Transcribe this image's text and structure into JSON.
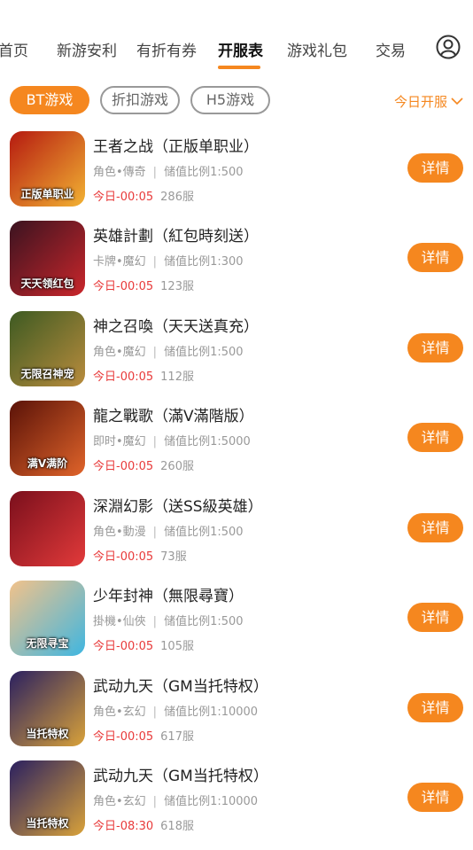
{
  "nav": {
    "items": [
      {
        "label": "首页"
      },
      {
        "label": "新游安利"
      },
      {
        "label": "有折有券"
      },
      {
        "label": "开服表",
        "active": true
      },
      {
        "label": "游戏礼包"
      },
      {
        "label": "交易"
      }
    ],
    "accent_color": "#f5871f"
  },
  "filters": {
    "chips": [
      {
        "label": "BT游戏",
        "active": true
      },
      {
        "label": "折扣游戏",
        "active": false
      },
      {
        "label": "H5游戏",
        "active": false
      }
    ],
    "date_filter": "今日开服"
  },
  "games": [
    {
      "title": "王者之战（正版单职业）",
      "genre": "角色•傳奇",
      "ratio": "储值比例1:500",
      "time": "今日-00:05",
      "server": "286服",
      "button": "详情",
      "icon_text": "正版单职业",
      "icon_colors": [
        "#b51a10",
        "#f2b233"
      ]
    },
    {
      "title": "英雄計劃（紅包時刻送）",
      "genre": "卡牌•魔幻",
      "ratio": "储值比例1:300",
      "time": "今日-00:05",
      "server": "123服",
      "button": "详情",
      "icon_text": "天天领红包",
      "icon_colors": [
        "#3a1320",
        "#c9262b"
      ]
    },
    {
      "title": "神之召喚（天天送真充）",
      "genre": "角色•魔幻",
      "ratio": "储值比例1:500",
      "time": "今日-00:05",
      "server": "112服",
      "button": "详情",
      "icon_text": "无限召神宠",
      "icon_colors": [
        "#3d5a22",
        "#b98c3d"
      ]
    },
    {
      "title": "龍之戰歌（滿V滿階版）",
      "genre": "即时•魔幻",
      "ratio": "储值比例1:5000",
      "time": "今日-00:05",
      "server": "260服",
      "button": "详情",
      "icon_text": "满V满阶",
      "icon_colors": [
        "#5a1208",
        "#e0642a"
      ]
    },
    {
      "title": "深淵幻影（送SS級英雄）",
      "genre": "角色•動漫",
      "ratio": "储值比例1:500",
      "time": "今日-00:05",
      "server": "73服",
      "button": "详情",
      "icon_text": "",
      "icon_colors": [
        "#7a0f1c",
        "#e23a3a"
      ]
    },
    {
      "title": "少年封神（無限尋寶）",
      "genre": "掛機•仙俠",
      "ratio": "储值比例1:500",
      "time": "今日-00:05",
      "server": "105服",
      "button": "详情",
      "icon_text": "无限寻宝",
      "icon_colors": [
        "#f2c28a",
        "#3fb6e0"
      ]
    },
    {
      "title": "武动九天（GM当托特权）",
      "genre": "角色•玄幻",
      "ratio": "储值比例1:10000",
      "time": "今日-00:05",
      "server": "617服",
      "button": "详情",
      "icon_text": "当托特权",
      "icon_colors": [
        "#2a2060",
        "#d9a23a"
      ]
    },
    {
      "title": "武动九天（GM当托特权）",
      "genre": "角色•玄幻",
      "ratio": "储值比例1:10000",
      "time": "今日-08:30",
      "server": "618服",
      "button": "详情",
      "icon_text": "当托特权",
      "icon_colors": [
        "#2a2060",
        "#d9a23a"
      ]
    }
  ]
}
